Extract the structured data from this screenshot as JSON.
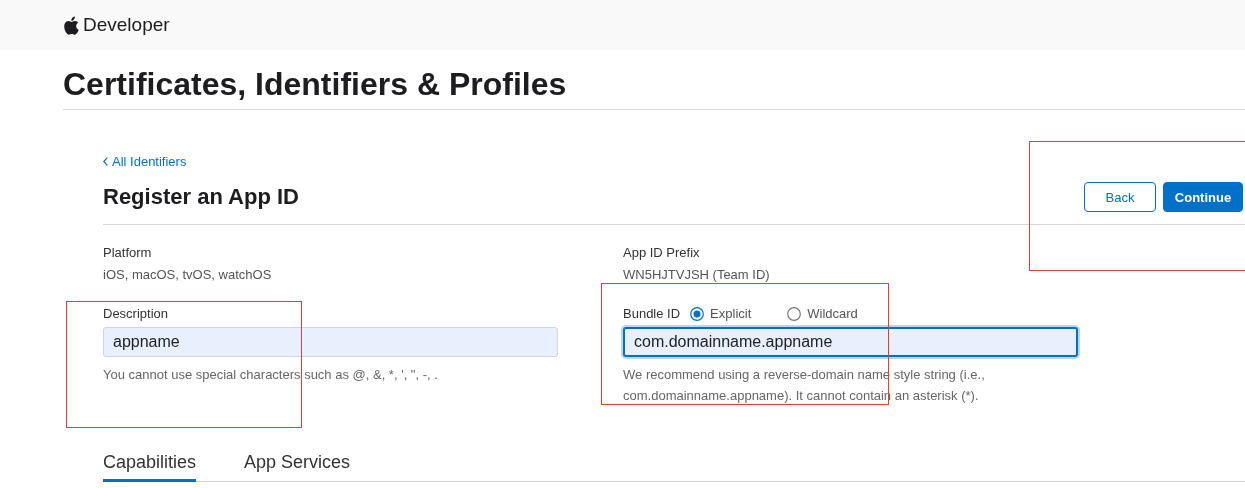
{
  "header": {
    "brand": "Developer"
  },
  "page_title": "Certificates, Identifiers & Profiles",
  "back_link": "All Identifiers",
  "heading": "Register an App ID",
  "buttons": [
    {
      "label": "Back",
      "kind": "secondary"
    },
    {
      "label": "Continue",
      "kind": "primary"
    }
  ],
  "platform": {
    "label": "Platform",
    "value": "iOS, macOS, tvOS, watchOS"
  },
  "prefix": {
    "label": "App ID Prefix",
    "value": "WN5HJTVJSH (Team ID)"
  },
  "description": {
    "label": "Description",
    "value": "appname",
    "focused": false,
    "help": "You cannot use special characters such as @, &, *, ', \", -, ."
  },
  "bundle_id": {
    "label": "Bundle ID",
    "value": "com.domainname.appname",
    "focused": true,
    "options": [
      {
        "label": "Explicit",
        "selected": true
      },
      {
        "label": "Wildcard",
        "selected": false
      }
    ],
    "help": "We recommend using a reverse-domain name style string (i.e., com.domainname.appname). It cannot contain an asterisk (*)."
  },
  "tabs": [
    {
      "label": "Capabilities",
      "selected": true
    },
    {
      "label": "App Services",
      "selected": false
    }
  ]
}
